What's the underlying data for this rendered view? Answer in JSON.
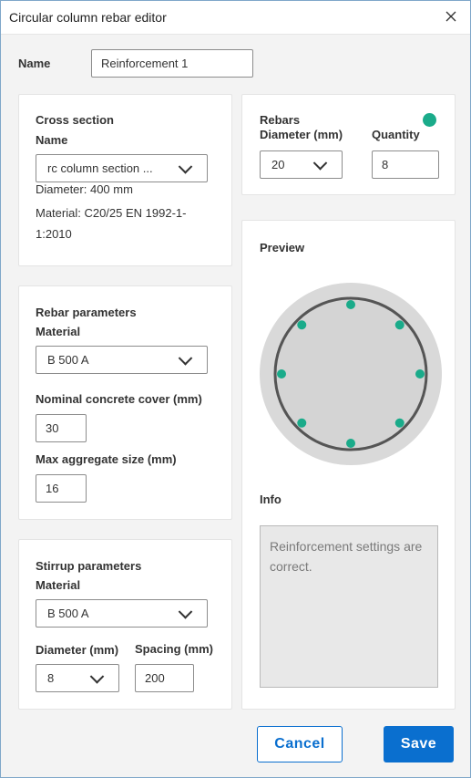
{
  "window": {
    "title": "Circular column rebar editor",
    "close_icon": "close-icon"
  },
  "name_field": {
    "label": "Name",
    "value": "Reinforcement 1"
  },
  "cross_section": {
    "heading": "Cross section",
    "name_label": "Name",
    "name_value": "rc column section ...",
    "diameter_text": "Diameter: 400 mm",
    "material_line1": "Material: C20/25 EN 1992-1-",
    "material_line2": "1:2010"
  },
  "rebars": {
    "heading": "Rebars",
    "diameter_label": "Diameter (mm)",
    "diameter_value": "20",
    "quantity_label": "Quantity",
    "quantity_value": "8",
    "status_color": "#1aab8a"
  },
  "rebar_parameters": {
    "heading": "Rebar parameters",
    "material_label": "Material",
    "material_value": "B 500 A",
    "cover_label": "Nominal concrete cover (mm)",
    "cover_value": "30",
    "aggregate_label": "Max aggregate size (mm)",
    "aggregate_value": "16"
  },
  "stirrup_parameters": {
    "heading": "Stirrup parameters",
    "material_label": "Material",
    "material_value": "B 500 A",
    "diameter_label": "Diameter (mm)",
    "diameter_value": "8",
    "spacing_label": "Spacing (mm)",
    "spacing_value": "200"
  },
  "preview": {
    "heading": "Preview",
    "rebar_count": 8,
    "bar_color": "#1aab8a"
  },
  "info": {
    "heading": "Info",
    "message": "Reinforcement settings are correct."
  },
  "buttons": {
    "cancel": "Cancel",
    "save": "Save"
  },
  "colors": {
    "accent": "#0a6fcf",
    "rebar": "#1aab8a"
  }
}
